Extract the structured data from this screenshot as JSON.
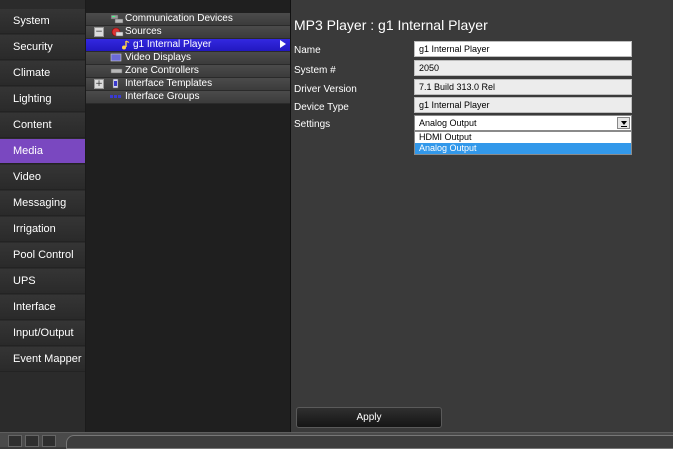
{
  "nav": {
    "items": [
      {
        "label": "System"
      },
      {
        "label": "Security"
      },
      {
        "label": "Climate"
      },
      {
        "label": "Lighting"
      },
      {
        "label": "Content"
      },
      {
        "label": "Media"
      },
      {
        "label": "Video"
      },
      {
        "label": "Messaging"
      },
      {
        "label": "Irrigation"
      },
      {
        "label": "Pool Control"
      },
      {
        "label": "UPS"
      },
      {
        "label": "Interface"
      },
      {
        "label": "Input/Output"
      },
      {
        "label": "Event Mapper"
      }
    ],
    "active": "Media",
    "accent": "#7a48c0"
  },
  "tree": {
    "items": [
      {
        "label": "Communication Devices"
      },
      {
        "label": "Sources",
        "expander": "−"
      },
      {
        "label": "g1 Internal Player"
      },
      {
        "label": "Video Displays"
      },
      {
        "label": "Zone Controllers"
      },
      {
        "label": "Interface Templates",
        "expander": "+"
      },
      {
        "label": "Interface Groups"
      }
    ],
    "selected": "g1 Internal Player",
    "selected_color": "#2a1fd6"
  },
  "detail": {
    "title": "MP3 Player : g1 Internal Player",
    "fields": {
      "name": {
        "label": "Name",
        "value": "g1 Internal Player"
      },
      "system_number": {
        "label": "System #",
        "value": "2050"
      },
      "driver_version": {
        "label": "Driver Version",
        "value": "7.1 Build 313.0 Rel"
      },
      "device_type": {
        "label": "Device Type",
        "value": "g1 Internal Player"
      }
    },
    "settings": {
      "label": "Settings",
      "selected": "Analog Output",
      "options": [
        "HDMI Output",
        "Analog Output"
      ],
      "highlight_color": "#3298ea"
    },
    "apply_label": "Apply"
  }
}
